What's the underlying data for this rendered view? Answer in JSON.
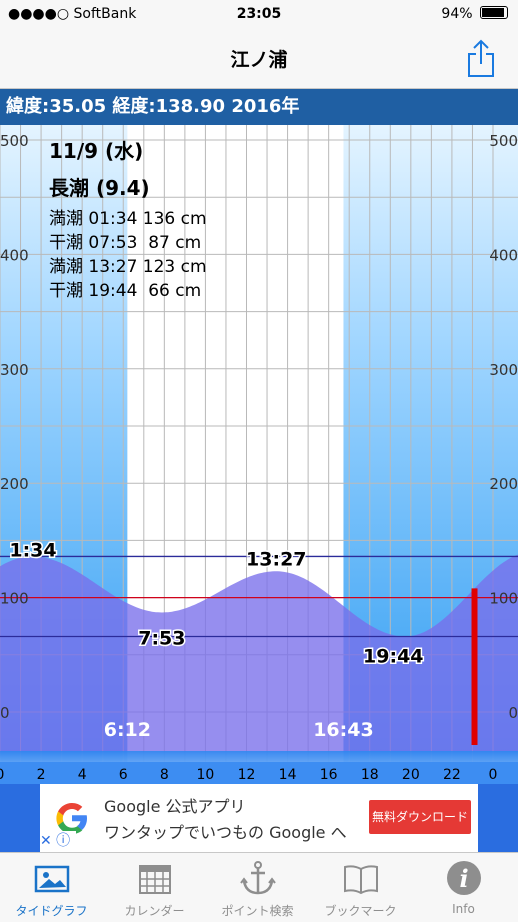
{
  "status_bar": {
    "carrier": "●●●●○ SoftBank",
    "time": "23:05",
    "battery": "94%"
  },
  "nav": {
    "title": "江ノ浦"
  },
  "info": {
    "coords": "緯度:35.05 経度:138.90  2016年"
  },
  "tide": {
    "date": "11/9 (水)",
    "kind": "長潮 (9.4)",
    "events": [
      {
        "type": "満潮",
        "time": "01:34",
        "height": "136 cm"
      },
      {
        "type": "干潮",
        "time": "07:53",
        "height": " 87 cm"
      },
      {
        "type": "満潮",
        "time": "13:27",
        "height": "123 cm"
      },
      {
        "type": "干潮",
        "time": "19:44",
        "height": " 66 cm"
      }
    ]
  },
  "chart_data": {
    "type": "area",
    "x_unit": "hour",
    "xlim": [
      0,
      24
    ],
    "ylim": [
      0,
      500
    ],
    "y_ticks": [
      "0",
      "100",
      "200",
      "300",
      "400",
      "500"
    ],
    "x_ticks": [
      "0",
      "2",
      "4",
      "6",
      "8",
      "10",
      "12",
      "14",
      "16",
      "18",
      "20",
      "22",
      "0"
    ],
    "sunrise": {
      "hour": 6.2,
      "label": "6:12"
    },
    "sunset": {
      "hour": 16.72,
      "label": "16:43"
    },
    "extremes": [
      {
        "hour": 1.57,
        "value": 136,
        "label": "1:34"
      },
      {
        "hour": 7.88,
        "value": 87,
        "label": "7:53"
      },
      {
        "hour": 13.45,
        "value": 123,
        "label": "13:27"
      },
      {
        "hour": 19.73,
        "value": 66,
        "label": "19:44"
      }
    ],
    "start_value": 120,
    "end_value": 125,
    "reference_lines": [
      {
        "value": 136,
        "color": "#2b2b9a"
      },
      {
        "value": 100,
        "color": "#d0021b"
      },
      {
        "value": 66,
        "color": "#2b2b9a"
      }
    ],
    "current_hour": 23.1,
    "current_color": "#e00000"
  },
  "ad": {
    "title": "Google 公式アプリ",
    "subtitle": "ワンタップでいつもの Google へ",
    "button": "無料ダウンロード"
  },
  "tabs": [
    {
      "label": "タイドグラフ",
      "icon": "photo-icon",
      "active": true
    },
    {
      "label": "カレンダー",
      "icon": "calendar-icon",
      "active": false
    },
    {
      "label": "ポイント検索",
      "icon": "anchor-icon",
      "active": false
    },
    {
      "label": "ブックマーク",
      "icon": "book-icon",
      "active": false
    },
    {
      "label": "Info",
      "icon": "info-icon",
      "active": false
    }
  ]
}
